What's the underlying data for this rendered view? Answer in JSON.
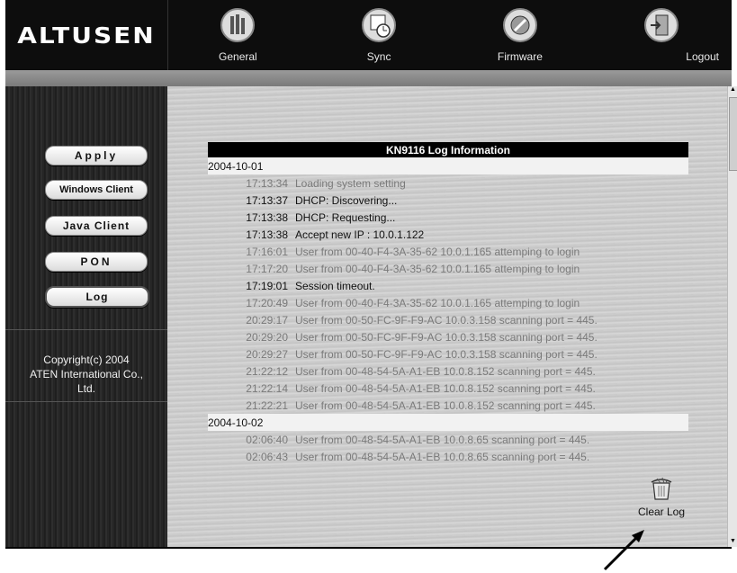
{
  "brand": {
    "logo": "ALTUSEN"
  },
  "nav": [
    {
      "label": "General",
      "icon": "general-icon"
    },
    {
      "label": "Sync",
      "icon": "sync-icon"
    },
    {
      "label": "Firmware",
      "icon": "firmware-icon"
    },
    {
      "label": "Logout",
      "icon": "logout-icon"
    }
  ],
  "sidebar": {
    "buttons": [
      "Apply",
      "Windows Client",
      "Java Client",
      "PON",
      "Log"
    ],
    "copyright": [
      "Copyright(c) 2004",
      "ATEN International Co.,",
      "Ltd."
    ]
  },
  "log": {
    "title": "KN9116 Log Information",
    "groups": [
      {
        "date": "2004-10-01",
        "entries": [
          {
            "time": "17:13:34",
            "msg": "Loading system setting"
          },
          {
            "time": "17:13:37",
            "msg": "DHCP: Discovering..."
          },
          {
            "time": "17:13:38",
            "msg": "DHCP: Requesting..."
          },
          {
            "time": "17:13:38",
            "msg": "Accept new IP : 10.0.1.122"
          },
          {
            "time": "17:16:01",
            "msg": "User from 00-40-F4-3A-35-62 10.0.1.165 attemping to login"
          },
          {
            "time": "17:17:20",
            "msg": "User from 00-40-F4-3A-35-62 10.0.1.165 attemping to login"
          },
          {
            "time": "17:19:01",
            "msg": "Session timeout."
          },
          {
            "time": "17:20:49",
            "msg": "User from 00-40-F4-3A-35-62 10.0.1.165 attemping to login"
          },
          {
            "time": "20:29:17",
            "msg": "User from 00-50-FC-9F-F9-AC 10.0.3.158 scanning port = 445."
          },
          {
            "time": "20:29:20",
            "msg": "User from 00-50-FC-9F-F9-AC 10.0.3.158 scanning port = 445."
          },
          {
            "time": "20:29:27",
            "msg": "User from 00-50-FC-9F-F9-AC 10.0.3.158 scanning port = 445."
          },
          {
            "time": "21:22:12",
            "msg": "User from 00-48-54-5A-A1-EB 10.0.8.152 scanning port = 445."
          },
          {
            "time": "21:22:14",
            "msg": "User from 00-48-54-5A-A1-EB 10.0.8.152 scanning port = 445."
          },
          {
            "time": "21:22:21",
            "msg": "User from 00-48-54-5A-A1-EB 10.0.8.152 scanning port = 445."
          }
        ]
      },
      {
        "date": "2004-10-02",
        "entries": [
          {
            "time": "02:06:40",
            "msg": "User from 00-48-54-5A-A1-EB 10.0.8.65 scanning port = 445."
          },
          {
            "time": "02:06:43",
            "msg": "User from 00-48-54-5A-A1-EB 10.0.8.65 scanning port = 445."
          }
        ]
      }
    ]
  },
  "clear_log": {
    "label": "Clear Log",
    "icon": "trash-icon"
  },
  "colors": {
    "topbar": "#0d0d0d",
    "title_bar": "#000000",
    "sidebar": "#222222"
  }
}
